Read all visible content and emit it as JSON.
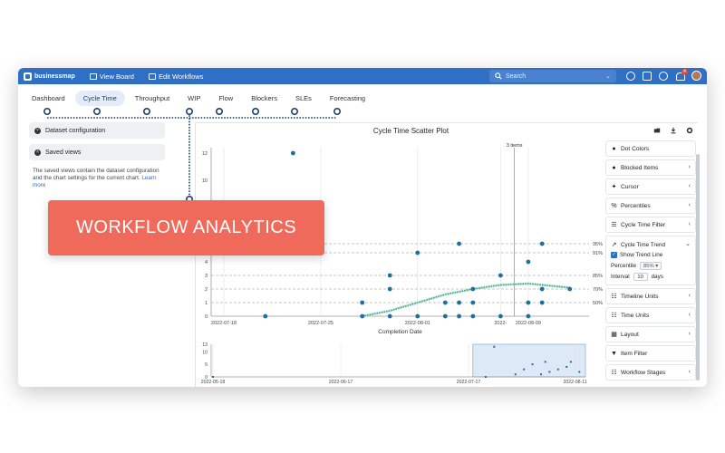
{
  "topbar": {
    "brand": "businessmap",
    "links": [
      "View Board",
      "Edit Workflows"
    ],
    "search_placeholder": "Search",
    "notification_count": "4"
  },
  "tabs": [
    "Dashboard",
    "Cycle Time",
    "Throughput",
    "WIP",
    "Flow",
    "Blockers",
    "SLEs",
    "Forecasting"
  ],
  "active_tab": "Cycle Time",
  "left_panel": {
    "dataset_label": "Dataset configuration",
    "saved_views_label": "Saved views",
    "saved_views_text": "The saved views contain the dataset configuration and the chart settings for the current chart.",
    "learn_more": "Learn more"
  },
  "cta": {
    "label": "WORKFLOW ANALYTICS"
  },
  "chart": {
    "title": "Cycle Time Scatter Plot",
    "cursor_label": "3 items",
    "xlabel": "Completion Date"
  },
  "chart_data": [
    {
      "type": "scatter",
      "title": "Cycle Time Scatter Plot",
      "xlabel": "Completion Date",
      "ylabel": "",
      "x_ticks": [
        "2022-07-18",
        "2022-07-25",
        "2022-08-01",
        "2022-",
        "2022-08-09"
      ],
      "y_ticks": [
        0,
        1,
        2,
        3,
        4,
        7,
        10,
        12
      ],
      "percentiles": [
        {
          "label": "95%",
          "value": 6
        },
        {
          "label": "91%",
          "value": 5
        },
        {
          "label": "85%",
          "value": 3
        },
        {
          "label": "70%",
          "value": 2
        },
        {
          "label": "50%",
          "value": 1
        }
      ],
      "points": [
        {
          "x": "2022-07-21",
          "y": 0
        },
        {
          "x": "2022-07-23",
          "y": 12
        },
        {
          "x": "2022-07-28",
          "y": 0
        },
        {
          "x": "2022-07-28",
          "y": 1
        },
        {
          "x": "2022-07-30",
          "y": 0
        },
        {
          "x": "2022-07-30",
          "y": 2
        },
        {
          "x": "2022-07-30",
          "y": 3
        },
        {
          "x": "2022-08-01",
          "y": 5
        },
        {
          "x": "2022-08-01",
          "y": 0
        },
        {
          "x": "2022-08-03",
          "y": 0
        },
        {
          "x": "2022-08-03",
          "y": 1
        },
        {
          "x": "2022-08-04",
          "y": 6
        },
        {
          "x": "2022-08-04",
          "y": 0
        },
        {
          "x": "2022-08-04",
          "y": 1
        },
        {
          "x": "2022-08-05",
          "y": 2
        },
        {
          "x": "2022-08-05",
          "y": 0
        },
        {
          "x": "2022-08-05",
          "y": 1
        },
        {
          "x": "2022-08-07",
          "y": 0
        },
        {
          "x": "2022-08-07",
          "y": 3
        },
        {
          "x": "2022-08-09",
          "y": 4
        },
        {
          "x": "2022-08-09",
          "y": 1
        },
        {
          "x": "2022-08-09",
          "y": 0
        },
        {
          "x": "2022-08-10",
          "y": 6
        },
        {
          "x": "2022-08-10",
          "y": 2
        },
        {
          "x": "2022-08-10",
          "y": 1
        },
        {
          "x": "2022-08-12",
          "y": 2
        }
      ],
      "trend": [
        {
          "x": "2022-07-28",
          "y": 0
        },
        {
          "x": "2022-07-30",
          "y": 0.4
        },
        {
          "x": "2022-08-01",
          "y": 1
        },
        {
          "x": "2022-08-03",
          "y": 1.6
        },
        {
          "x": "2022-08-05",
          "y": 2
        },
        {
          "x": "2022-08-07",
          "y": 2.3
        },
        {
          "x": "2022-08-09",
          "y": 2.4
        },
        {
          "x": "2022-08-12",
          "y": 2.1
        }
      ]
    },
    {
      "type": "bar",
      "title": "",
      "x_ticks": [
        "2022-05-18",
        "2022-06-17",
        "2022-07-17",
        "2022-08-11"
      ],
      "y_ticks": [
        0,
        5,
        10,
        13
      ],
      "points": [
        {
          "x": "2022-05-18",
          "y": 0
        },
        {
          "x": "2022-07-21",
          "y": 0
        },
        {
          "x": "2022-07-23",
          "y": 12
        },
        {
          "x": "2022-07-28",
          "y": 1
        },
        {
          "x": "2022-07-30",
          "y": 3
        },
        {
          "x": "2022-08-01",
          "y": 5
        },
        {
          "x": "2022-08-03",
          "y": 1
        },
        {
          "x": "2022-08-04",
          "y": 6
        },
        {
          "x": "2022-08-05",
          "y": 2
        },
        {
          "x": "2022-08-07",
          "y": 3
        },
        {
          "x": "2022-08-09",
          "y": 4
        },
        {
          "x": "2022-08-10",
          "y": 6
        },
        {
          "x": "2022-08-12",
          "y": 2
        }
      ]
    }
  ],
  "right_panel": {
    "items_top": [
      "Dot Colors",
      "Blocked Items",
      "Cursor",
      "Percentiles",
      "Cycle Time Filter"
    ],
    "trend": {
      "title": "Cycle Time Trend",
      "show_label": "Show Trend Line",
      "percentile_label": "Percentile",
      "percentile_value": "85%",
      "interval_label": "Interval",
      "interval_value": "10",
      "interval_unit": "days"
    },
    "items_bottom": [
      "Timeline Units",
      "Time Units",
      "Layout",
      "Item Filter",
      "Workflow Stages"
    ]
  },
  "colors": {
    "accent": "#2f6fc6",
    "point": "#1e6f9f",
    "trend": "#2e9a78",
    "cta": "#ef6a5a"
  }
}
